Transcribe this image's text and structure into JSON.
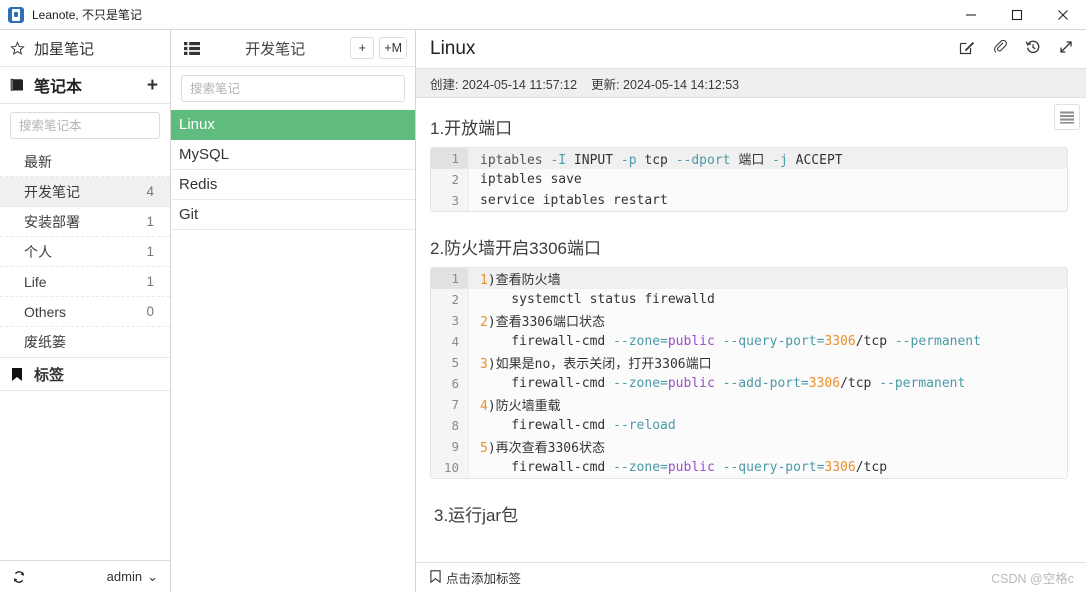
{
  "window": {
    "app_title": "Leanote, 不只是笔记",
    "logo_icon": "leanote-logo",
    "minimize_label": "—",
    "maximize_label": "□",
    "close_label": "✕"
  },
  "sidebar": {
    "starred": {
      "icon": "star-icon",
      "label": "加星笔记"
    },
    "notebooks": {
      "icon": "notebook-icon",
      "label": "笔记本",
      "add_label": "+"
    },
    "search_placeholder": "搜索笔记本",
    "notebooks_list": [
      {
        "label": "最新",
        "count": ""
      },
      {
        "label": "开发笔记",
        "count": "4",
        "active": true
      },
      {
        "label": "安装部署",
        "count": "1"
      },
      {
        "label": "个人",
        "count": "1"
      },
      {
        "label": "Life",
        "count": "1"
      },
      {
        "label": "Others",
        "count": "0"
      },
      {
        "label": "废纸篓",
        "count": ""
      }
    ],
    "tags": {
      "icon": "tag-icon",
      "label": "标签"
    },
    "footer": {
      "sync_icon": "sync-icon",
      "user": "admin",
      "caret": "⌄"
    }
  },
  "notelist": {
    "grid_icon": "list-view-icon",
    "title": "开发笔记",
    "add_note_label": "+",
    "add_markdown_label": "+M",
    "search_placeholder": "搜索笔记",
    "notes": [
      {
        "title": "Linux",
        "selected": true
      },
      {
        "title": "MySQL",
        "selected": false
      },
      {
        "title": "Redis",
        "selected": false
      },
      {
        "title": "Git",
        "selected": false
      }
    ]
  },
  "note": {
    "title": "Linux",
    "tools": [
      {
        "name": "edit-icon"
      },
      {
        "name": "attachment-icon"
      },
      {
        "name": "history-icon"
      },
      {
        "name": "fullscreen-icon"
      }
    ],
    "created_label": "创建: 2024-05-14 11:57:12",
    "updated_label": "更新: 2024-05-14 14:12:53",
    "toc_icon": "toc-icon",
    "headings": {
      "h1": "1.开放端口",
      "h2": "2.防火墙开启3306端口",
      "h3": "3.运行jar包"
    },
    "code_block_1": {
      "lines": [
        {
          "n": "1",
          "highlighted": true,
          "parts": [
            {
              "t": "iptables ",
              "c": "plain"
            },
            {
              "t": "-I",
              "c": "flag"
            },
            {
              "t": " INPUT ",
              "c": "plain"
            },
            {
              "t": "-p",
              "c": "flag"
            },
            {
              "t": " tcp ",
              "c": "plain"
            },
            {
              "t": "--dport",
              "c": "flag"
            },
            {
              "t": " 端口 ",
              "c": "plain"
            },
            {
              "t": "-j",
              "c": "flag"
            },
            {
              "t": " ACCEPT",
              "c": "plain"
            }
          ]
        },
        {
          "n": "2",
          "highlighted": false,
          "parts": [
            {
              "t": "iptables save",
              "c": "plain"
            }
          ]
        },
        {
          "n": "3",
          "highlighted": false,
          "parts": [
            {
              "t": "service iptables restart",
              "c": "plain"
            }
          ]
        }
      ]
    },
    "code_block_2": {
      "lines": [
        {
          "n": "1",
          "highlighted": true,
          "parts": [
            {
              "t": "1",
              "c": "num"
            },
            {
              "t": ")查看防火墙",
              "c": "plain"
            }
          ]
        },
        {
          "n": "2",
          "highlighted": false,
          "parts": [
            {
              "t": "    systemctl status firewalld",
              "c": "plain"
            }
          ]
        },
        {
          "n": "3",
          "highlighted": false,
          "parts": [
            {
              "t": "2",
              "c": "num"
            },
            {
              "t": ")查看3306端口状态",
              "c": "plain"
            }
          ]
        },
        {
          "n": "4",
          "highlighted": false,
          "parts": [
            {
              "t": "    firewall-cmd ",
              "c": "plain"
            },
            {
              "t": "--zone=",
              "c": "flag"
            },
            {
              "t": "public",
              "c": "val"
            },
            {
              "t": " ",
              "c": "plain"
            },
            {
              "t": "--query-port=",
              "c": "flag"
            },
            {
              "t": "3306",
              "c": "num"
            },
            {
              "t": "/tcp ",
              "c": "plain"
            },
            {
              "t": "--permanent",
              "c": "flag"
            }
          ]
        },
        {
          "n": "5",
          "highlighted": false,
          "parts": [
            {
              "t": "3",
              "c": "num"
            },
            {
              "t": ")如果是no，表示关闭，打开3306端口",
              "c": "plain"
            }
          ]
        },
        {
          "n": "6",
          "highlighted": false,
          "parts": [
            {
              "t": "    firewall-cmd ",
              "c": "plain"
            },
            {
              "t": "--zone=",
              "c": "flag"
            },
            {
              "t": "public",
              "c": "val"
            },
            {
              "t": " ",
              "c": "plain"
            },
            {
              "t": "--add-port=",
              "c": "flag"
            },
            {
              "t": "3306",
              "c": "num"
            },
            {
              "t": "/tcp ",
              "c": "plain"
            },
            {
              "t": "--permanent",
              "c": "flag"
            }
          ]
        },
        {
          "n": "7",
          "highlighted": false,
          "parts": [
            {
              "t": "4",
              "c": "num"
            },
            {
              "t": ")防火墙重载",
              "c": "plain"
            }
          ]
        },
        {
          "n": "8",
          "highlighted": false,
          "parts": [
            {
              "t": "    firewall-cmd ",
              "c": "plain"
            },
            {
              "t": "--reload",
              "c": "flag"
            }
          ]
        },
        {
          "n": "9",
          "highlighted": false,
          "parts": [
            {
              "t": "5",
              "c": "num"
            },
            {
              "t": ")再次查看3306状态",
              "c": "plain"
            }
          ]
        },
        {
          "n": "10",
          "highlighted": false,
          "parts": [
            {
              "t": "    firewall-cmd ",
              "c": "plain"
            },
            {
              "t": "--zone=",
              "c": "flag"
            },
            {
              "t": "public",
              "c": "val"
            },
            {
              "t": " ",
              "c": "plain"
            },
            {
              "t": "--query-port=",
              "c": "flag"
            },
            {
              "t": "3306",
              "c": "num"
            },
            {
              "t": "/tcp",
              "c": "plain"
            }
          ]
        }
      ]
    },
    "footer": {
      "tag_icon": "tag-icon",
      "add_tag_label": "点击添加标签",
      "watermark": "CSDN @空格c"
    }
  },
  "colors": {
    "accent_green": "#5fbb7e",
    "brand_blue": "#2f6fb5",
    "code_flag": "#4a9aa8",
    "code_number": "#e8912a",
    "code_value": "#9a4ecb"
  }
}
